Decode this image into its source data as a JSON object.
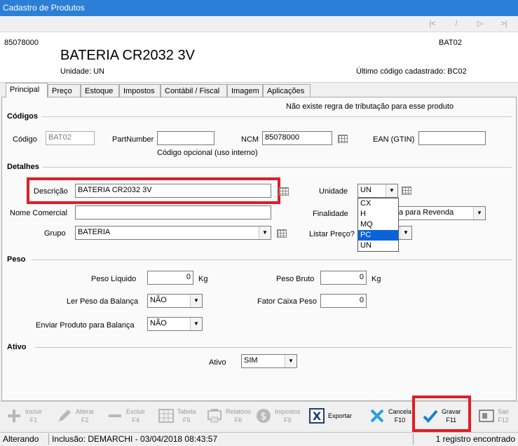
{
  "window": {
    "title": "Cadastro de Produtos"
  },
  "nav": [
    "first-icon",
    "prev-icon",
    "next-icon",
    "last-icon"
  ],
  "header": {
    "ncm": "85078000",
    "code": "BAT02",
    "name": "BATERIA CR2032 3V",
    "unit_label": "Unidade:",
    "unit_value": "UN",
    "last_code_label": "Último código cadastrado:",
    "last_code_value": "BC02"
  },
  "tabs": [
    "Principal",
    "Preço",
    "Estoque",
    "Impostos",
    "Contábil / Fiscal",
    "Imagem",
    "Aplicações"
  ],
  "info_message": "Não existe regra de tributação para esse produto",
  "codigos": {
    "section": "Códigos",
    "codigo_label": "Código",
    "codigo_value": "BAT02",
    "partnumber_label": "PartNumber",
    "partnumber_value": "",
    "optional_note": "Código opcional (uso interno)",
    "ncm_label": "NCM",
    "ncm_value": "85078000",
    "ean_label": "EAN (GTIN)",
    "ean_value": ""
  },
  "detalhes": {
    "section": "Detalhes",
    "descricao_label": "Descrição",
    "descricao_value": "BATERIA CR2032 3V",
    "nome_comercial_label": "Nome Comercial",
    "nome_comercial_value": "",
    "grupo_label": "Grupo",
    "grupo_value": "BATERIA",
    "unidade_label": "Unidade",
    "unidade_value": "UN",
    "unidade_options": [
      "CX",
      "H",
      "MQ",
      "PC",
      "UN"
    ],
    "unidade_selected": "PC",
    "finalidade_label": "Finalidade",
    "finalidade_value": "a para Revenda",
    "listar_preco_label": "Listar Preço?"
  },
  "peso": {
    "section": "Peso",
    "liquido_label": "Peso Líquido",
    "liquido_value": "0",
    "bruto_label": "Peso Bruto",
    "bruto_value": "0",
    "unit": "Kg",
    "ler_balanca_label": "Ler Peso da Balança",
    "ler_balanca_value": "NÃO",
    "fator_label": "Fator Caixa Peso",
    "fator_value": "0",
    "enviar_balanca_label": "Enviar Produto para Balança",
    "enviar_balanca_value": "NÃO"
  },
  "ativo": {
    "section": "Ativo",
    "label": "Ativo",
    "value": "SIM"
  },
  "toolbar": [
    {
      "name": "Incluir",
      "key": "F1",
      "icon": "plus-icon",
      "enabled": false
    },
    {
      "name": "Alterar",
      "key": "F2",
      "icon": "pencil-icon",
      "enabled": false
    },
    {
      "name": "Excluir",
      "key": "F4",
      "icon": "minus-icon",
      "enabled": false
    },
    {
      "name": "Tabela",
      "key": "F5",
      "icon": "table-icon",
      "enabled": false
    },
    {
      "name": "Relatório",
      "key": "F6",
      "icon": "report-icon",
      "enabled": false
    },
    {
      "name": "Impostos",
      "key": "F9",
      "icon": "dollar-icon",
      "enabled": false
    },
    {
      "name": "Exportar",
      "key": "",
      "icon": "export-icon",
      "enabled": true
    },
    {
      "name": "Cancela",
      "key": "F10",
      "icon": "cancel-icon",
      "enabled": true
    },
    {
      "name": "Gravar",
      "key": "F11",
      "icon": "check-icon",
      "enabled": true
    },
    {
      "name": "Sair",
      "key": "F12",
      "icon": "exit-icon",
      "enabled": false
    }
  ],
  "status": {
    "mode": "Alterando",
    "inclusion": "Inclusão: DEMARCHI - 03/04/2018 08:43:57",
    "records": "1 registro encontrado"
  },
  "colors": {
    "title_bar": "#2b7fd6",
    "highlight": "#e01e26",
    "selection": "#0a64d8"
  }
}
